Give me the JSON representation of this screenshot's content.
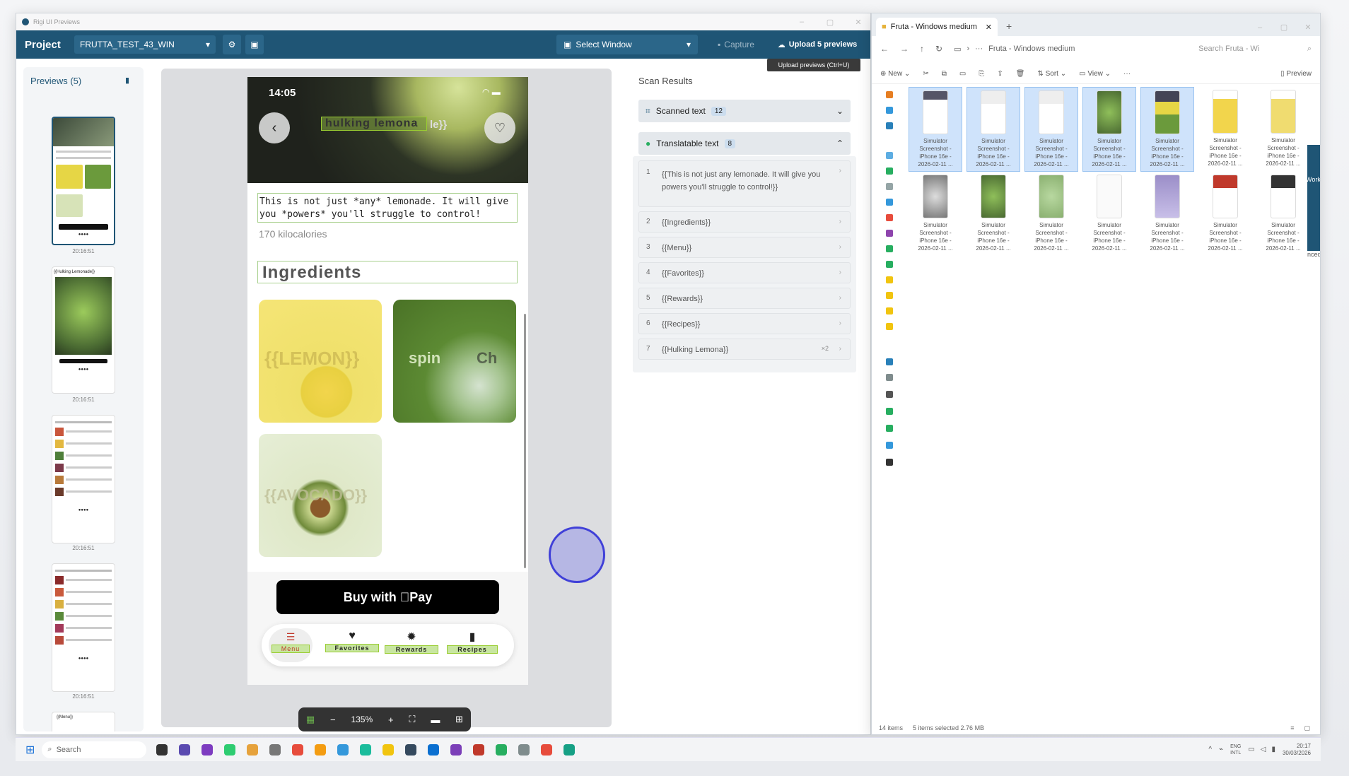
{
  "app": {
    "title": "Rigi UI Previews",
    "project_label": "Project",
    "project_value": "FRUTTA_TEST_43_WIN",
    "select_window": "Select Window",
    "capture": "Capture",
    "upload": "Upload 5 previews",
    "upload_tooltip": "Upload previews (Ctrl+U)"
  },
  "sidebar": {
    "title": "Previews (5)",
    "thumb_times": [
      "20:16:51",
      "20:16:51",
      "20:16:51",
      "20:16:51"
    ],
    "thumb2_title": "{{Hulking Lemonade}}",
    "thumb5_title": "{{Menu}}"
  },
  "phone": {
    "time": "14:05",
    "header_title": "hulking lemona",
    "header_suffix": "le}}",
    "description": "This is not just *any* lemonade. It will give you *powers* you'll struggle to control!",
    "kcal": "170 kilocalories",
    "ingredients_heading": "Ingredients",
    "ing1": "{{LEMON}}",
    "ing2a": "spin",
    "ing2b": "Ch",
    "ing3": "{{AVOCADO}}",
    "pay_label": "Buy with Pay",
    "tabs": [
      "Menu",
      "Favorites",
      "Rewards",
      "Recipes"
    ]
  },
  "zoom": {
    "level": "135%"
  },
  "results": {
    "title": "Scan Results",
    "scanned_label": "Scanned text",
    "scanned_count": "12",
    "translatable_label": "Translatable text",
    "translatable_count": "8",
    "rows": [
      {
        "n": "1",
        "text": "{{This is not just any lemonade. It will give you powers you'll struggle to control!}}",
        "c": ""
      },
      {
        "n": "2",
        "text": "{{Ingredients}}",
        "c": ""
      },
      {
        "n": "3",
        "text": "{{Menu}}",
        "c": ""
      },
      {
        "n": "4",
        "text": "{{Favorites}}",
        "c": ""
      },
      {
        "n": "5",
        "text": "{{Rewards}}",
        "c": ""
      },
      {
        "n": "6",
        "text": "{{Recipes}}",
        "c": ""
      },
      {
        "n": "7",
        "text": "{{Hulking Lemona}}",
        "c": "×2"
      }
    ]
  },
  "explorer": {
    "tab_title": "Fruta - Windows medium",
    "path": "Fruta - Windows medium",
    "search_placeholder": "Search Fruta - Wi",
    "new": "New",
    "sort": "Sort",
    "view": "View",
    "preview": "Preview",
    "file_label": [
      "Simulator",
      "Screenshot -",
      "iPhone 16e -",
      "2026-02-11 ..."
    ],
    "status_items": "14 items",
    "status_selected": "5 items selected  2.76 MB",
    "side_right_top": "Work",
    "side_right_bottom": "nced"
  },
  "taskbar": {
    "search": "Search",
    "lang1": "ENG",
    "lang2": "INTL",
    "time": "20:17",
    "date": "30/03/2026"
  },
  "colors": {
    "toolbar": "#1f5575",
    "accent_green": "#6ab04c",
    "cursor_circle": "#4444dd"
  }
}
